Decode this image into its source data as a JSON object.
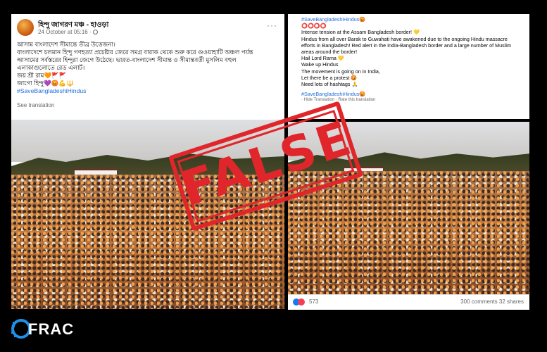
{
  "left_post": {
    "page_name": "হিন্দু জাগরণ মঞ্চ - হাওড়া",
    "date": "24 October at 05:16 ·",
    "more_label": "···",
    "lines": [
      "আসাম বাংলাদেশ সীমান্তে তীব্র উত্তেজনা।",
      "বাংলাদেশে চলমান হিন্দু গণহত্যা প্রচেষ্টার জেরে সমগ্র বারাক থেকে শুরু করে গুওয়াহাটি অঞ্চল পর্যন্ত",
      "আসামের সর্বস্তরের হিন্দুরা জেগে উঠেছে। ভারত-বাংলাদেশ সীমান্ত ও সীমান্তবর্তী মুসলিম বহুল",
      "এলাকাগুলোতে রেড এলার্ট।",
      "জয় শ্রী রাম🧡🚩🚩",
      "জাগো হিন্দু💜😡💪🔱"
    ],
    "hashtag": "#SaveBangladeshiHindus",
    "see_translation": "See translation"
  },
  "right_post": {
    "hashtag_top": "#SaveBangladeshiHindus😡",
    "lines": [
      "⭕⭕⭕⭕",
      "Intense tension at the Assam Bangladesh border! 💛",
      "Hindus from all over Barak to Guwahati have awakened due to the ongoing Hindu massacre",
      "efforts in Bangladesh! Red alert in the India-Bangladesh border and a large number of Muslim",
      "areas around the border!",
      "Hail Lord Rama 💛",
      "Wake up Hindus",
      "The movement is going on in India,",
      "Let there be a protest 😡",
      "Need lots of hashtags 🙏"
    ],
    "hashtag": "#SaveBangladeshiHindus😡",
    "links": "· Hide Translation · Rate this translation",
    "reaction_count": "573",
    "comments_shares": "300 comments  32 shares"
  },
  "stamp": {
    "label": "FALSE"
  },
  "logo": {
    "text": "FRAC"
  },
  "colors": {
    "stamp": "#e0262b",
    "link": "#216fdb",
    "background": "#000000"
  }
}
